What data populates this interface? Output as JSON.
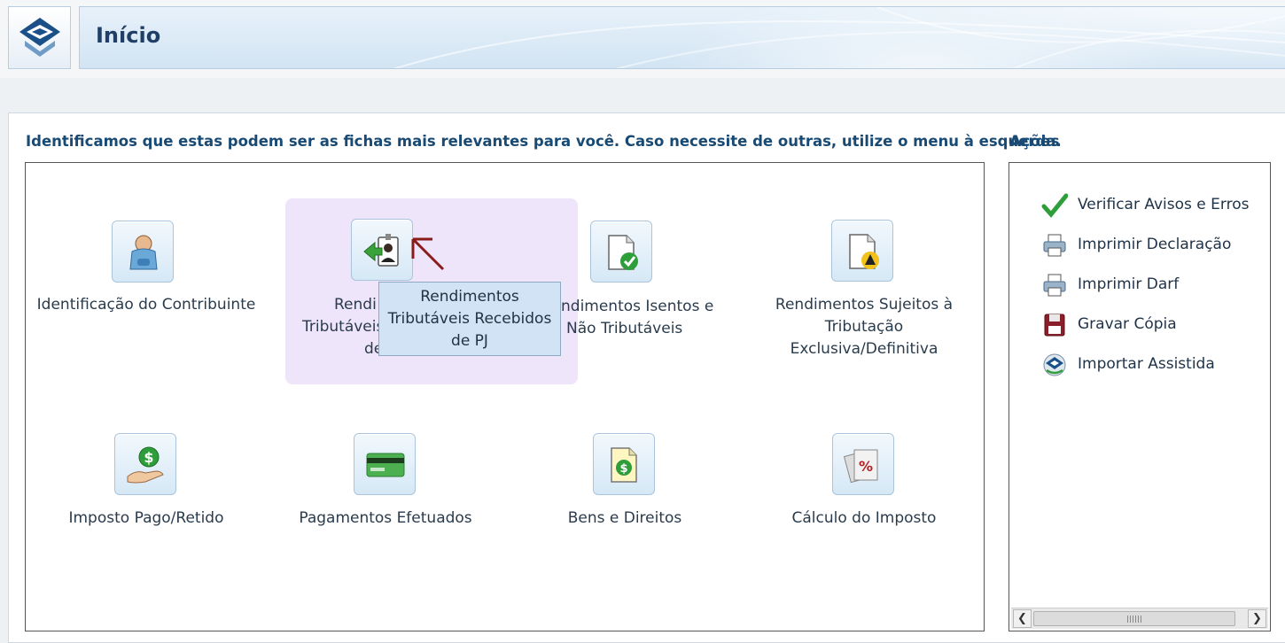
{
  "header": {
    "title": "Início"
  },
  "main": {
    "intro": "Identificamos que estas podem ser as fichas mais relevantes para você. Caso necessite de outras, utilize o menu à esquerda.",
    "tiles": [
      {
        "label": "Identificação do Contribuinte",
        "icon": "person-icon"
      },
      {
        "label": "Rendimentos Tributáveis Recebidos de PJ",
        "icon": "badge-person-arrow-icon",
        "visible_fragments": [
          "Rendi",
          "Tributáveis",
          "de"
        ]
      },
      {
        "label": "Rendimentos Isentos e Não Tributáveis",
        "icon": "document-check-icon",
        "visible_fragments": [
          "ndimentos Isentos e",
          "Não Tributáveis"
        ]
      },
      {
        "label": "Rendimentos Sujeitos à Tributação Exclusiva/Definitiva",
        "icon": "document-warning-icon"
      },
      {
        "label": "Imposto Pago/Retido",
        "icon": "hand-money-icon"
      },
      {
        "label": "Pagamentos Efetuados",
        "icon": "credit-card-icon"
      },
      {
        "label": "Bens e Direitos",
        "icon": "document-money-icon"
      },
      {
        "label": "Cálculo do Imposto",
        "icon": "percent-document-icon"
      }
    ],
    "tooltip": "Rendimentos Tributáveis Recebidos de PJ"
  },
  "actions": {
    "title": "Ações",
    "items": [
      {
        "label": "Verificar Avisos e Erros",
        "icon": "checkmark-icon"
      },
      {
        "label": "Imprimir Declaração",
        "icon": "printer-icon"
      },
      {
        "label": "Imprimir Darf",
        "icon": "printer-icon"
      },
      {
        "label": "Gravar Cópia",
        "icon": "floppy-disk-icon"
      },
      {
        "label": "Importar Assistida",
        "icon": "import-assist-icon"
      }
    ]
  },
  "colors": {
    "heading": "#184a74",
    "hover": "#efe5fb",
    "tooltip": "#d1e3f5",
    "accent_arrow": "#8b1a1a"
  }
}
